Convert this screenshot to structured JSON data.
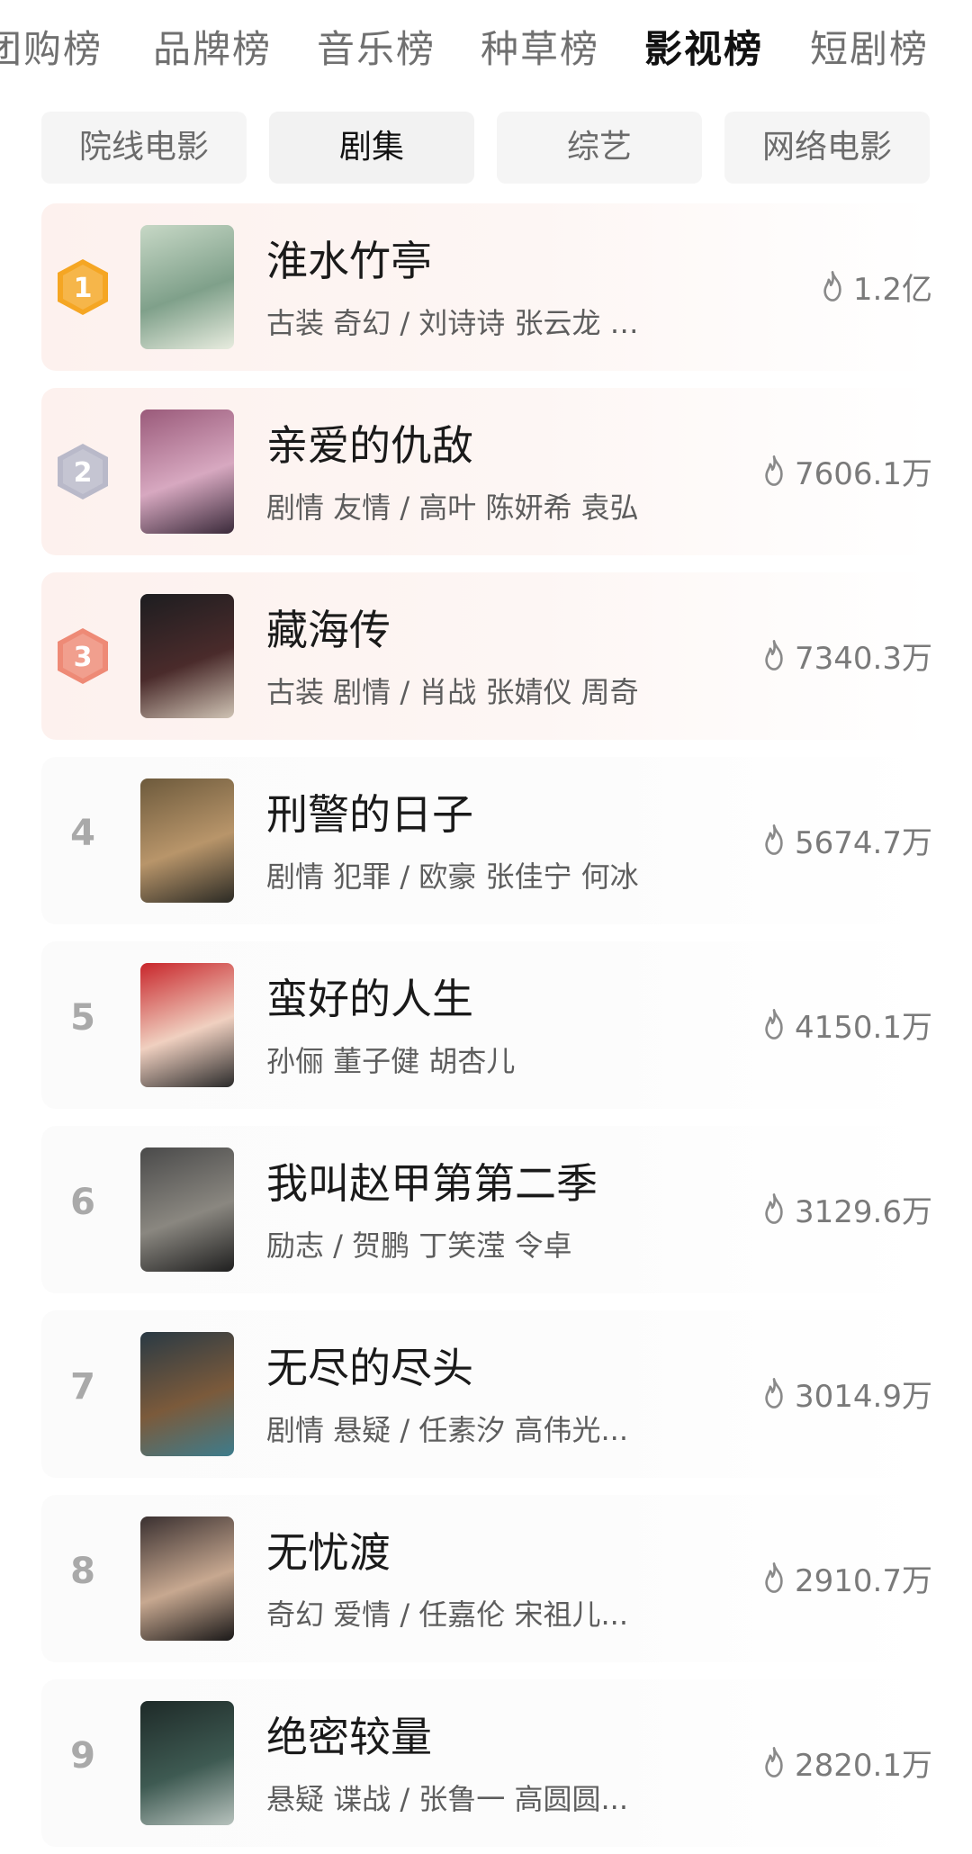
{
  "top_tabs": [
    {
      "label": "团购榜",
      "active": false
    },
    {
      "label": "品牌榜",
      "active": false
    },
    {
      "label": "音乐榜",
      "active": false
    },
    {
      "label": "种草榜",
      "active": false
    },
    {
      "label": "影视榜",
      "active": true
    },
    {
      "label": "短剧榜",
      "active": false
    }
  ],
  "sub_tabs": [
    {
      "label": "院线电影",
      "active": false
    },
    {
      "label": "剧集",
      "active": true
    },
    {
      "label": "综艺",
      "active": false
    },
    {
      "label": "网络电影",
      "active": false
    }
  ],
  "colors": {
    "gold_badge": "#f5a623",
    "silver_badge": "#b9b9c9",
    "bronze_badge": "#ee8a76",
    "flame_icon": "#8a8a8a"
  },
  "items": [
    {
      "rank": "1",
      "badge": "gold",
      "title": "淮水竹亭",
      "meta": "古装 奇幻 / 刘诗诗 张云龙 吴宣仪",
      "heat": "1.2亿",
      "poster_colors": [
        "#c7d8c6",
        "#7fa08a",
        "#e8ecdf"
      ]
    },
    {
      "rank": "2",
      "badge": "silver",
      "title": "亲爱的仇敌",
      "meta": "剧情 友情 / 高叶 陈妍希 袁弘",
      "heat": "7606.1万",
      "poster_colors": [
        "#9a5a7a",
        "#d7a8c0",
        "#3a2a3a"
      ]
    },
    {
      "rank": "3",
      "badge": "bronze",
      "title": "藏海传",
      "meta": "古装 剧情 / 肖战 张婧仪 周奇",
      "heat": "7340.3万",
      "poster_colors": [
        "#1d1d20",
        "#4a2b2b",
        "#cfc3b4"
      ]
    },
    {
      "rank": "4",
      "badge": "",
      "title": "刑警的日子",
      "meta": "剧情 犯罪 / 欧豪 张佳宁 何冰",
      "heat": "5674.7万",
      "poster_colors": [
        "#6d5a3c",
        "#b8956a",
        "#2b2a24"
      ]
    },
    {
      "rank": "5",
      "badge": "",
      "title": "蛮好的人生",
      "meta": "孙俪 董子健 胡杏儿",
      "heat": "4150.1万",
      "poster_colors": [
        "#c8262b",
        "#f0d0c0",
        "#2a2a2a"
      ]
    },
    {
      "rank": "6",
      "badge": "",
      "title": "我叫赵甲第第二季",
      "meta": "励志 / 贺鹏 丁笑滢 令卓",
      "heat": "3129.6万",
      "poster_colors": [
        "#4a4a4a",
        "#8a8780",
        "#1f1f1f"
      ]
    },
    {
      "rank": "7",
      "badge": "",
      "title": "无尽的尽头",
      "meta": "剧情 悬疑 / 任素汐 高伟光...",
      "heat": "3014.9万",
      "poster_colors": [
        "#2a3a44",
        "#7b5a3b",
        "#3d7c8c"
      ]
    },
    {
      "rank": "8",
      "badge": "",
      "title": "无忧渡",
      "meta": "奇幻 爱情 / 任嘉伦 宋祖儿...",
      "heat": "2910.7万",
      "poster_colors": [
        "#3a3030",
        "#c7a890",
        "#1a1818"
      ]
    },
    {
      "rank": "9",
      "badge": "",
      "title": "绝密较量",
      "meta": "悬疑 谍战 / 张鲁一 高圆圆...",
      "heat": "2820.1万",
      "poster_colors": [
        "#1e2a28",
        "#3e5a52",
        "#b7c2bd"
      ]
    }
  ]
}
